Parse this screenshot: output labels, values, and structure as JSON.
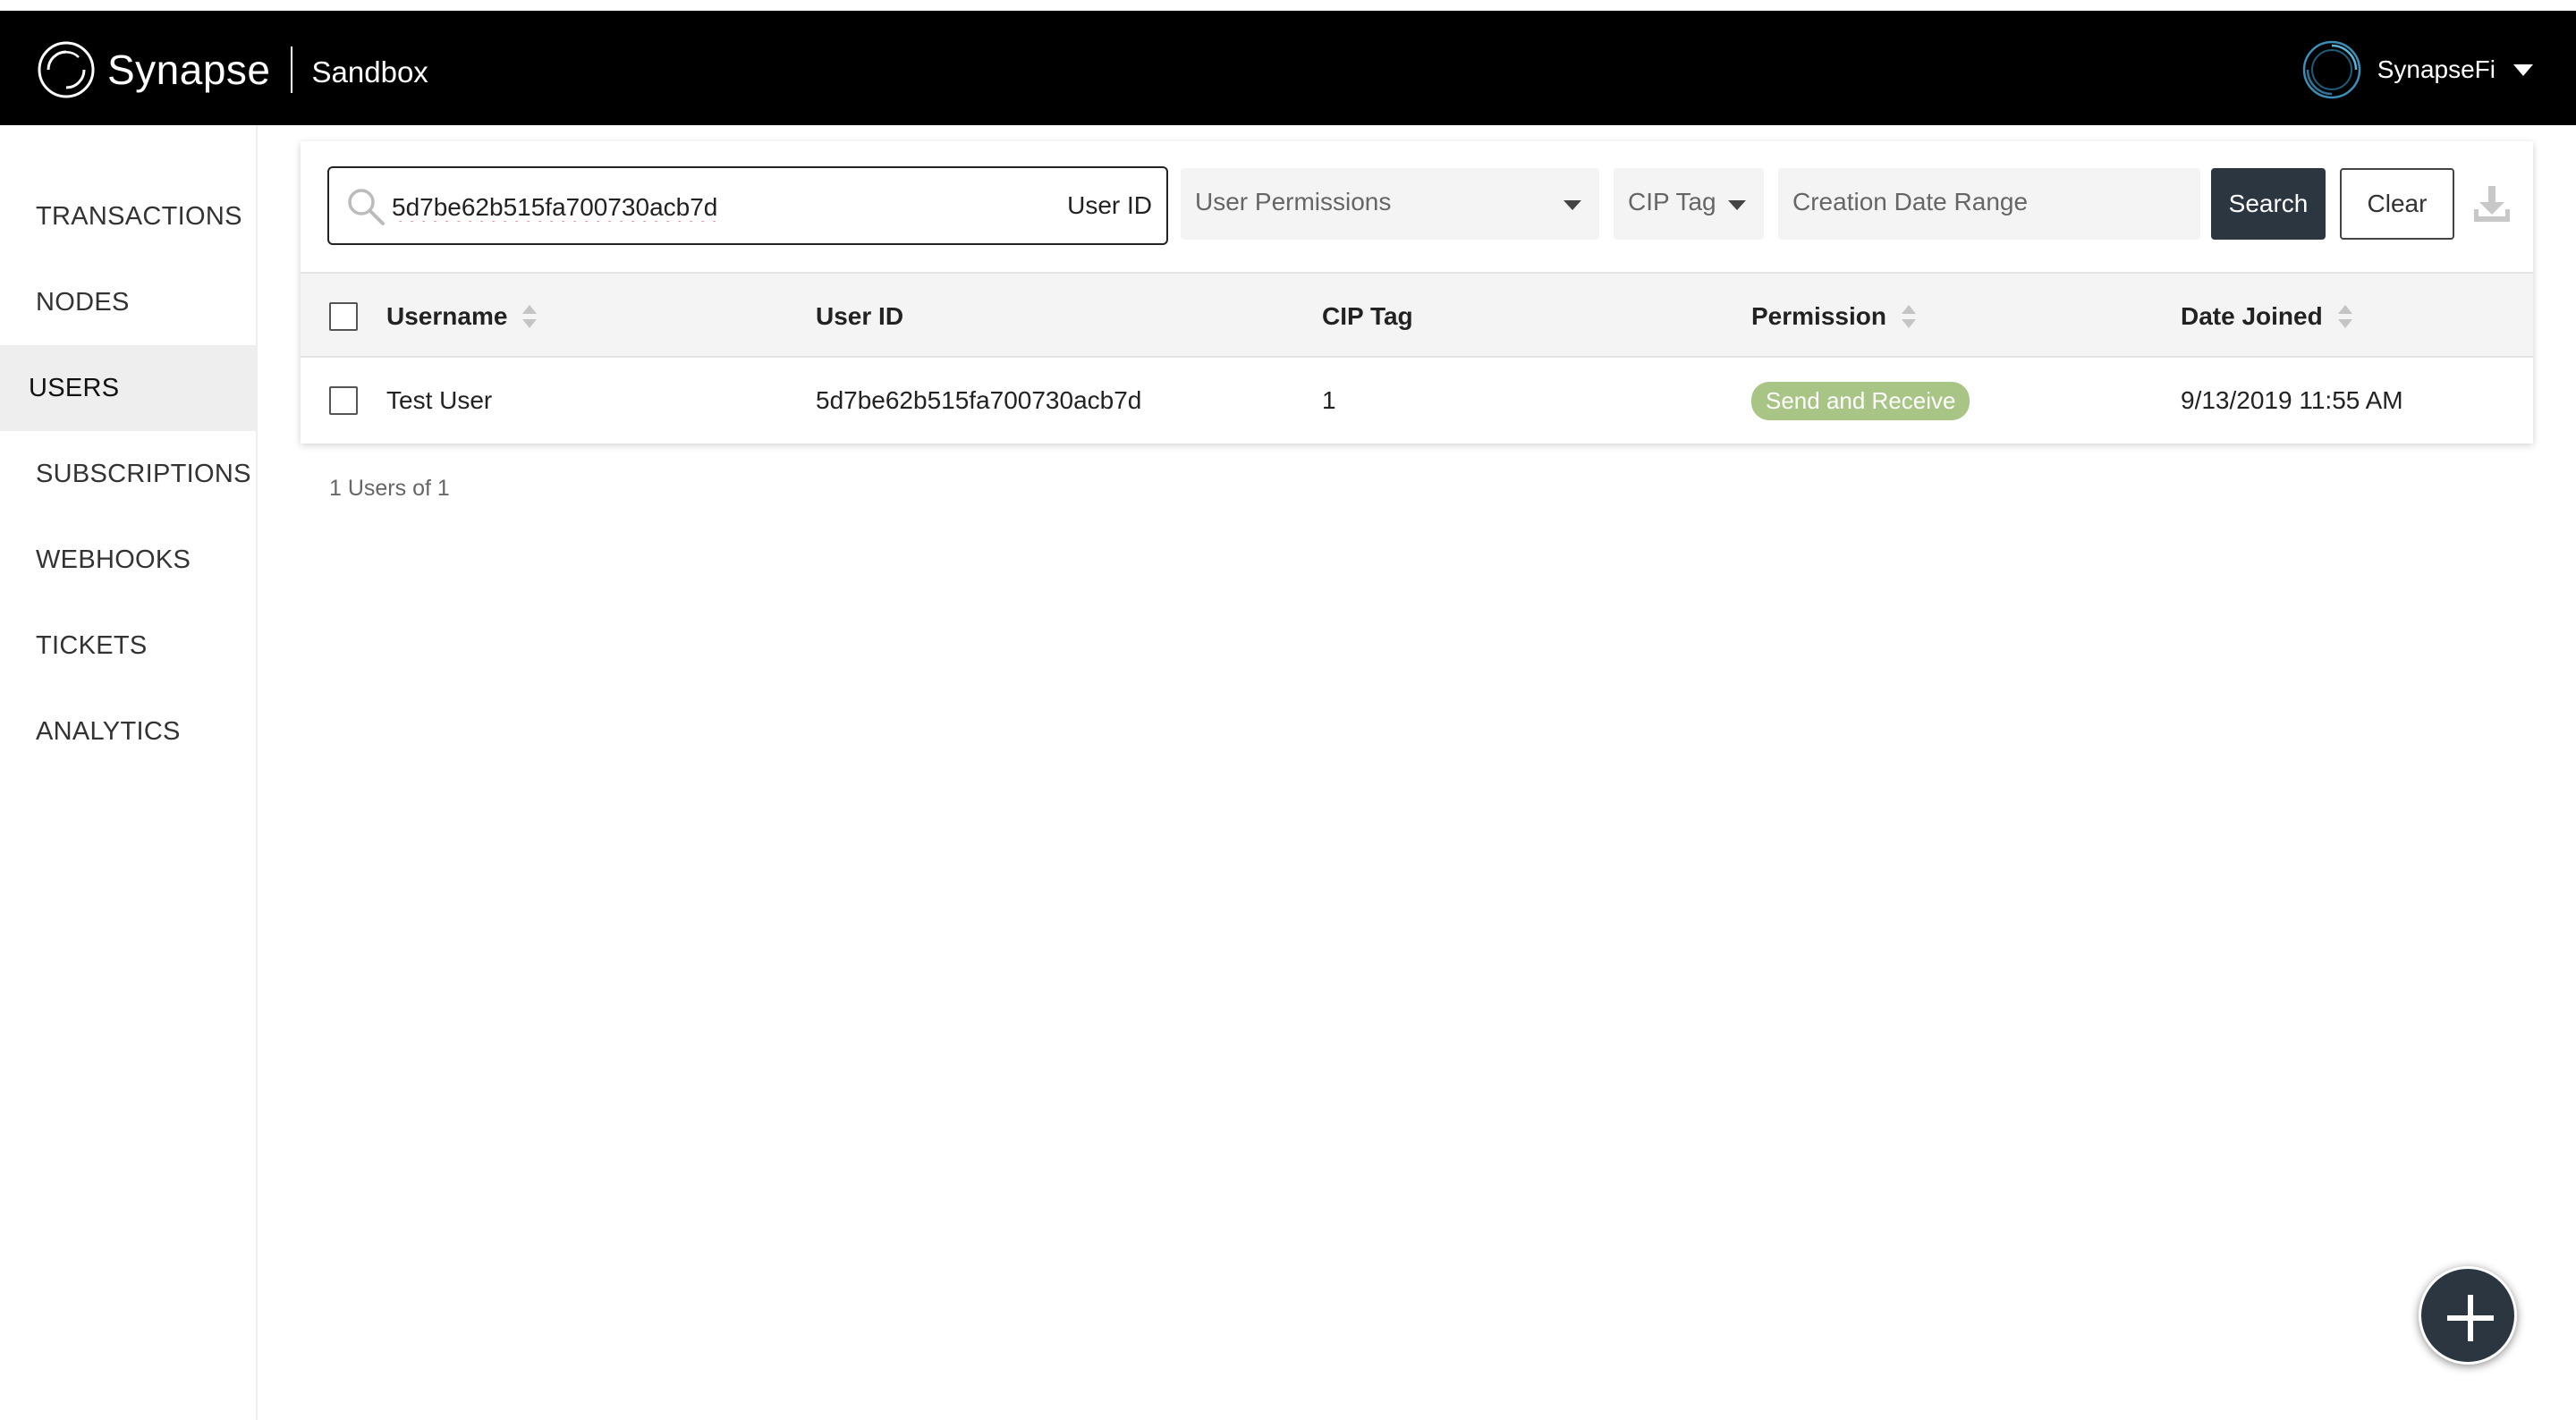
{
  "header": {
    "brand": "Synapse",
    "environment": "Sandbox",
    "account_name": "SynapseFi"
  },
  "sidebar": {
    "items": [
      {
        "label": "TRANSACTIONS",
        "active": false
      },
      {
        "label": "NODES",
        "active": false
      },
      {
        "label": "USERS",
        "active": true
      },
      {
        "label": "SUBSCRIPTIONS",
        "active": false
      },
      {
        "label": "WEBHOOKS",
        "active": false
      },
      {
        "label": "TICKETS",
        "active": false
      },
      {
        "label": "ANALYTICS",
        "active": false
      }
    ]
  },
  "filters": {
    "search_value": "5d7be62b515fa700730acb7d",
    "search_type": "User ID",
    "permissions_placeholder": "User Permissions",
    "cip_placeholder": "CIP Tag",
    "date_range_placeholder": "Creation Date Range",
    "search_label": "Search",
    "clear_label": "Clear"
  },
  "table": {
    "columns": {
      "username": "Username",
      "user_id": "User ID",
      "cip_tag": "CIP Tag",
      "permission": "Permission",
      "date_joined": "Date Joined"
    },
    "rows": [
      {
        "username": "Test User",
        "user_id": "5d7be62b515fa700730acb7d",
        "cip_tag": "1",
        "permission": "Send and Receive",
        "date_joined": "9/13/2019 11:55 AM"
      }
    ]
  },
  "footer": {
    "count_text": "1 Users of 1"
  },
  "colors": {
    "header_bg": "#000000",
    "primary_button": "#2c3640",
    "permission_badge": "#a8c586",
    "active_nav_bg": "#eeeeee"
  },
  "icons": {
    "logo": "synapse-ring-icon",
    "avatar": "ring-avatar-icon",
    "search": "search-icon",
    "download": "download-icon",
    "sort": "sort-icon",
    "fab": "plus-icon"
  }
}
